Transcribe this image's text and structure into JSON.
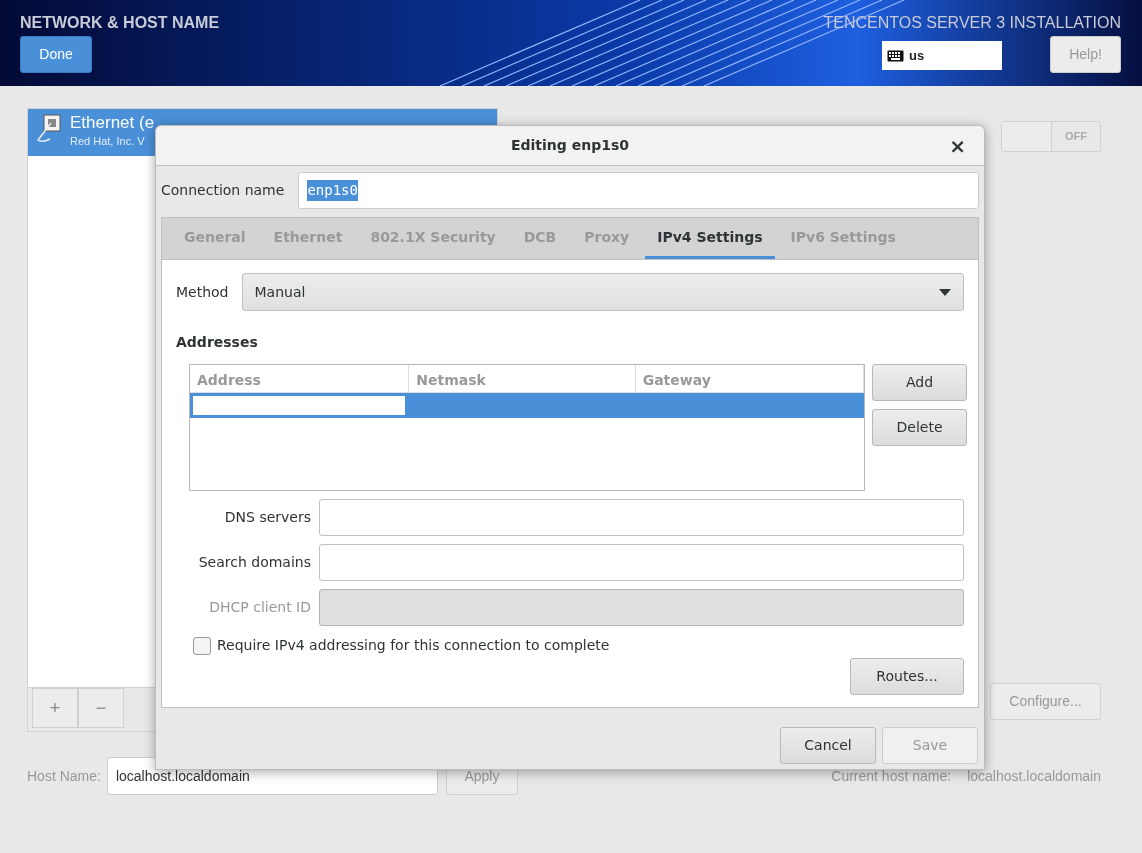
{
  "header": {
    "title": "NETWORK & HOST NAME",
    "done_button": "Done",
    "product_title": "TENCENTOS SERVER 3 INSTALLATION",
    "keyboard_layout": "us",
    "help_button": "Help!"
  },
  "devices": [
    {
      "name": "Ethernet (e",
      "description": "Red Hat, Inc. V",
      "selected": true
    }
  ],
  "device_switch": {
    "label": "OFF",
    "on": false
  },
  "list_buttons": [
    "+",
    "−"
  ],
  "configure_button": "Configure...",
  "host_name": {
    "label": "Host Name:",
    "value": "localhost.localdomain",
    "apply_button": "Apply"
  },
  "current_host_name": {
    "label": "Current host name:",
    "value": "localhost.localdomain"
  },
  "dialog": {
    "title": "Editing enp1s0",
    "close": "×",
    "connection_name": {
      "label": "Connection name",
      "value": "enp1s0",
      "text_selected": true
    },
    "tabs": [
      {
        "label": "General",
        "selected": false
      },
      {
        "label": "Ethernet",
        "selected": false
      },
      {
        "label": "802.1X Security",
        "selected": false
      },
      {
        "label": "DCB",
        "selected": false
      },
      {
        "label": "Proxy",
        "selected": false
      },
      {
        "label": "IPv4 Settings",
        "selected": true
      },
      {
        "label": "IPv6 Settings",
        "selected": false
      }
    ],
    "method": {
      "label": "Method",
      "value": "Manual"
    },
    "addresses": {
      "label": "Addresses",
      "columns": [
        "Address",
        "Netmask",
        "Gateway"
      ],
      "rows": [
        {
          "selected": true,
          "editing": true
        }
      ],
      "buttons": [
        {
          "label": "Add"
        },
        {
          "label": "Delete"
        }
      ]
    },
    "fields": [
      {
        "label": "DNS servers",
        "disabled": false
      },
      {
        "label": "Search domains",
        "disabled": false
      },
      {
        "label": "DHCP client ID",
        "disabled": true
      }
    ],
    "require_checkbox": {
      "label": "Require IPv4 addressing for this connection to complete",
      "checked": false
    },
    "routes_button": "Routes...",
    "footer_buttons": [
      {
        "label": "Cancel",
        "disabled": false
      },
      {
        "label": "Save",
        "disabled": true
      }
    ]
  }
}
